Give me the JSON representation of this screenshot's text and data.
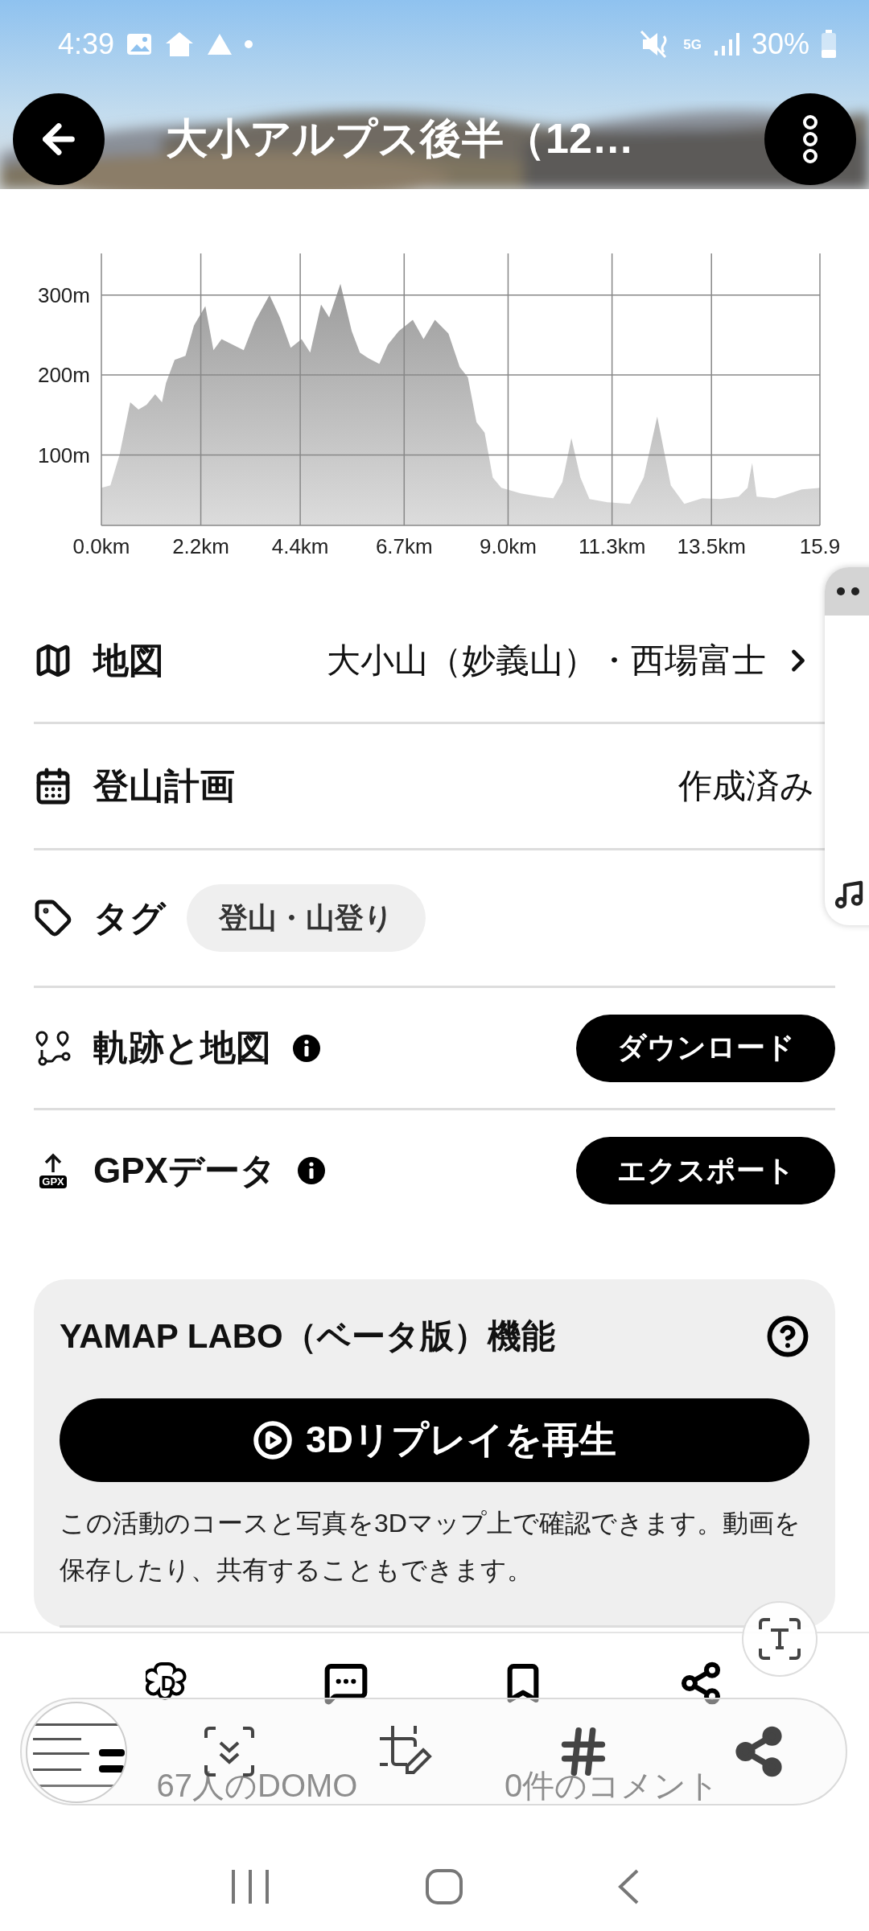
{
  "status_bar": {
    "time": "4:39",
    "network": "5G",
    "battery": "30%"
  },
  "header": {
    "title": "大小アルプス後半（12…"
  },
  "elevation_chart": {
    "chart_data": {
      "type": "area",
      "x": [
        0,
        0.2,
        0.4,
        0.64,
        0.82,
        1.0,
        1.19,
        1.34,
        1.43,
        1.62,
        1.86,
        2.05,
        2.3,
        2.48,
        2.66,
        2.9,
        3.15,
        3.39,
        3.72,
        3.95,
        4.19,
        4.43,
        4.62,
        4.86,
        5.04,
        5.29,
        5.54,
        5.72,
        5.91,
        6.15,
        6.34,
        6.58,
        6.89,
        7.13,
        7.38,
        7.68,
        7.93,
        8.11,
        8.3,
        8.48,
        8.66,
        8.85,
        9.28,
        9.7,
        10.0,
        10.2,
        10.4,
        10.6,
        10.8,
        11.2,
        11.7,
        12.0,
        12.3,
        12.6,
        12.9,
        13.3,
        13.7,
        14.1,
        14.3,
        14.4,
        14.5,
        14.9,
        15.5,
        15.9
      ],
      "series": [
        {
          "color": "#9c9c9c",
          "values": [
            59,
            62,
            100,
            166,
            157,
            163,
            176,
            166,
            190,
            219,
            224,
            262,
            286,
            231,
            245,
            238,
            231,
            266,
            300,
            272,
            234,
            245,
            228,
            288,
            272,
            314,
            255,
            228,
            221,
            214,
            238,
            255,
            269,
            245,
            269,
            252,
            210,
            197,
            141,
            128,
            72,
            59,
            52,
            48,
            46,
            66,
            121,
            72,
            45,
            41,
            39,
            72,
            148,
            62,
            39,
            46,
            45,
            48,
            59,
            90,
            48,
            46,
            57,
            59
          ]
        }
      ],
      "xlim": [
        0,
        15.9
      ],
      "ylim": [
        12,
        352
      ],
      "grid": true,
      "xticks": [
        {
          "value": 0,
          "label": "0.0km"
        },
        {
          "value": 2.2,
          "label": "2.2km"
        },
        {
          "value": 4.4,
          "label": "4.4km"
        },
        {
          "value": 6.7,
          "label": "6.7km"
        },
        {
          "value": 9.0,
          "label": "9.0km"
        },
        {
          "value": 11.3,
          "label": "11.3km"
        },
        {
          "value": 13.5,
          "label": "13.5km"
        },
        {
          "value": 15.9,
          "label": "15.9"
        }
      ],
      "yticks": [
        {
          "value": 100,
          "label": "100m"
        },
        {
          "value": 200,
          "label": "200m"
        },
        {
          "value": 300,
          "label": "300m"
        }
      ]
    }
  },
  "rows": [
    {
      "kind": "link",
      "label": "地図",
      "value": "大小山（妙義山）・西場富士"
    },
    {
      "kind": "value",
      "label": "登山計画",
      "value": "作成済み"
    },
    {
      "kind": "tags",
      "label": "タグ",
      "tags": [
        "登山・山登り"
      ]
    },
    {
      "kind": "action",
      "label": "軌跡と地図",
      "info": true,
      "button": "ダウンロード"
    },
    {
      "kind": "action",
      "label": "GPXデータ",
      "info": true,
      "button": "エクスポート",
      "icon_badge": "GPX"
    }
  ],
  "labo": {
    "title": "YAMAP LABO（ベータ版）機能",
    "button": "3Dリプレイを再生",
    "description": "この活動のコースと写真を3Dマップ上で確認できます。動画を保存したり、共有することもできます。"
  },
  "action_bar": {
    "domo_badge": "D",
    "domo": "67人のDOMO",
    "comments": "0件のコメント"
  }
}
